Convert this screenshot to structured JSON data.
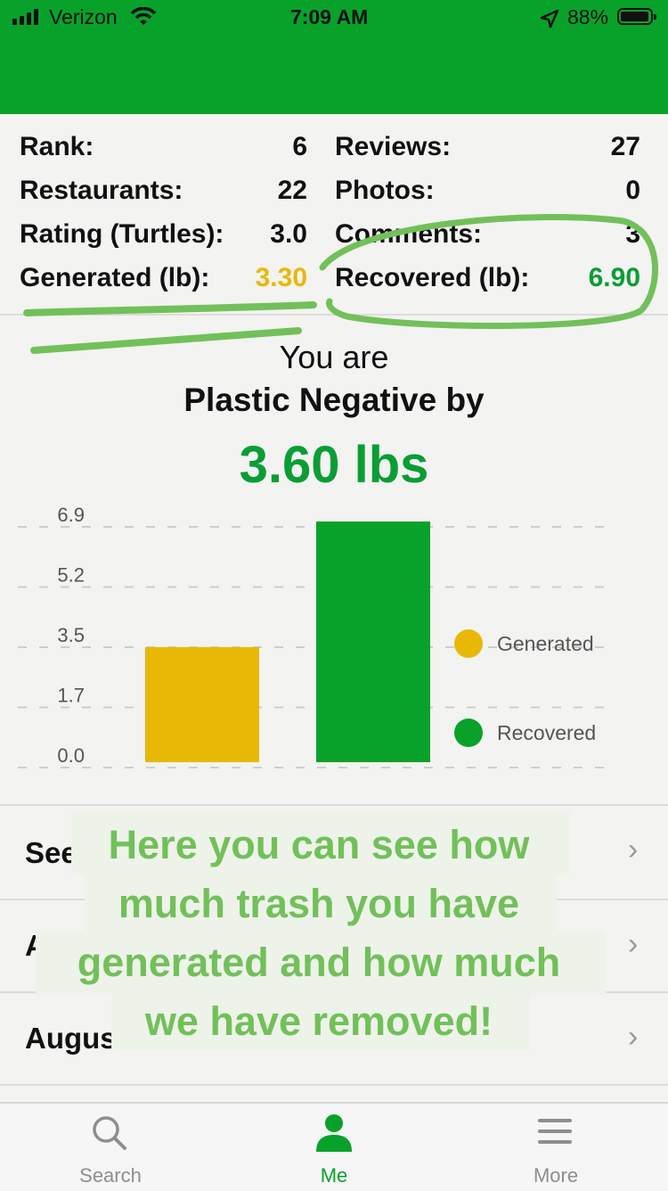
{
  "status_bar": {
    "carrier": "Verizon",
    "time": "7:09 AM",
    "battery": "88%"
  },
  "stats": {
    "left": [
      {
        "label": "Rank:",
        "value": "6"
      },
      {
        "label": "Restaurants:",
        "value": "22"
      },
      {
        "label": "Rating (Turtles):",
        "value": "3.0"
      },
      {
        "label": "Generated (lb):",
        "value": "3.30"
      }
    ],
    "right": [
      {
        "label": "Reviews:",
        "value": "27"
      },
      {
        "label": "Photos:",
        "value": "0"
      },
      {
        "label": "Comments:",
        "value": "3"
      },
      {
        "label": "Recovered (lb):",
        "value": "6.90"
      }
    ]
  },
  "summary": {
    "line1": "You are",
    "line2": "Plastic Negative by",
    "amount": "3.60 lbs"
  },
  "chart_data": {
    "type": "bar",
    "categories": [
      "Generated",
      "Recovered"
    ],
    "values": [
      3.3,
      6.9
    ],
    "colors": [
      "#e9b807",
      "#08a22a"
    ],
    "y_ticks": [
      "6.9",
      "5.2",
      "3.5",
      "1.7",
      "0.0"
    ],
    "ylim": [
      0,
      6.9
    ],
    "grid": true,
    "legend": [
      "Generated",
      "Recovered"
    ],
    "legend_position": "right"
  },
  "list": {
    "rows": [
      {
        "visible_text": "See"
      },
      {
        "visible_text": "A"
      },
      {
        "visible_text": "Augus"
      }
    ],
    "chevron": "›"
  },
  "overlay": {
    "lines": [
      "Here you can see how",
      "much trash you have",
      "generated and how much",
      "we have removed!"
    ],
    "color": "#72c05a"
  },
  "tabs": [
    {
      "label": "Search",
      "icon": "search-icon",
      "active": false
    },
    {
      "label": "Me",
      "icon": "person-icon",
      "active": true
    },
    {
      "label": "More",
      "icon": "menu-icon",
      "active": false
    }
  ],
  "colors": {
    "brand_green": "#08a22a",
    "generated": "#e9b807",
    "recovered": "#0a9d35",
    "annotation": "#72c05a"
  }
}
